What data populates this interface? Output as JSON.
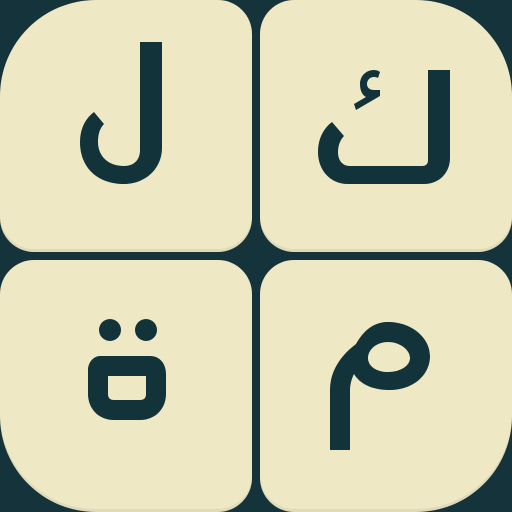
{
  "board": {
    "tiles": [
      {
        "letter": "ل",
        "position": "top-left"
      },
      {
        "letter": "ك",
        "position": "top-right"
      },
      {
        "letter": "ة",
        "position": "bottom-left"
      },
      {
        "letter": "م",
        "position": "bottom-right"
      }
    ]
  },
  "colors": {
    "background": "#14333a",
    "tile": "#efe8c4",
    "glyph": "#12333a"
  }
}
